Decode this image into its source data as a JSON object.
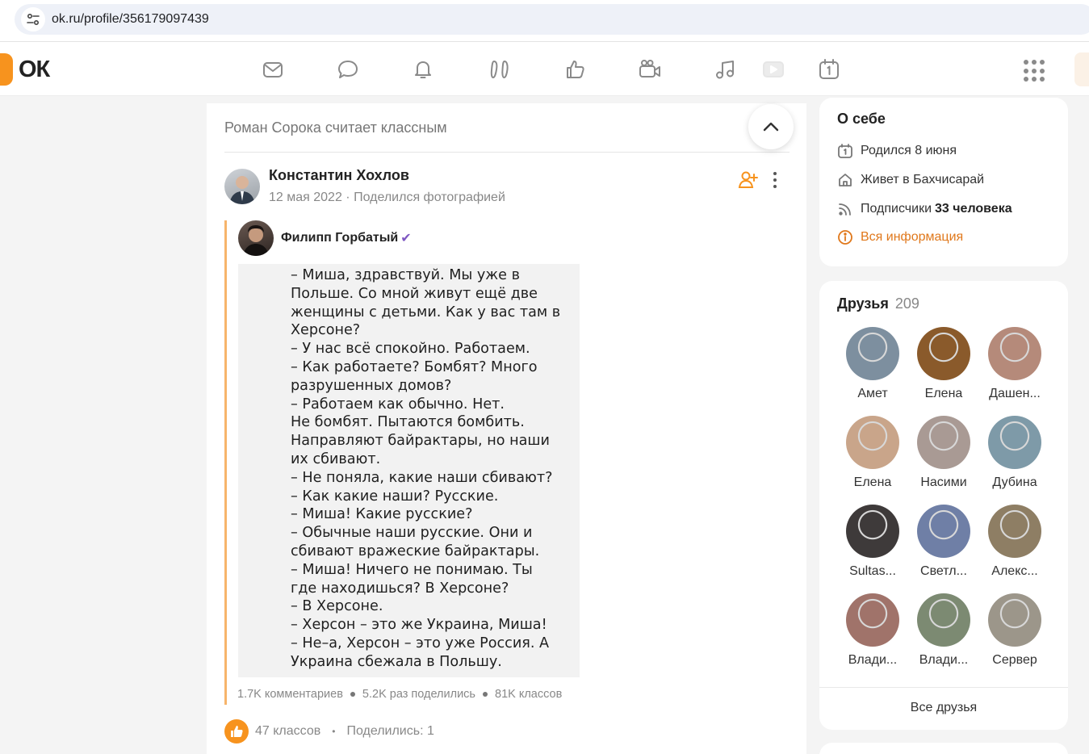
{
  "browser": {
    "url": "ok.ru/profile/356179097439"
  },
  "header": {
    "logo_text": "ОК",
    "nav_icons": [
      "mail-icon",
      "chat-icon",
      "bell-icon",
      "friends-icon",
      "like-icon",
      "video-icon",
      "music-icon",
      "play-icon",
      "calendar-icon"
    ],
    "accent_color": "#f7931e"
  },
  "feed": {
    "activity_header": "Роман Сорока считает классным",
    "post": {
      "author_name": "Константин Хохлов",
      "date": "12 мая 2022",
      "action": "Поделился фотографией",
      "repost": {
        "author_name": "Филипп Горбатый",
        "verified_glyph": "✔",
        "photo_text": "– Миша, здравствуй. Мы уже в\nПольше. Со мной живут ещё две\nженщины с детьми. Как у вас там в\nХерсоне?\n– У нас всё спокойно. Работаем.\n– Как работаете? Бомбят? Много\nразрушенных домов?\n– Работаем как обычно. Нет.\nНе бомбят. Пытаются бомбить.\nНаправляют байрактары, но наши\nих сбивают.\n– Не поняла, какие наши сбивают?\n– Как какие наши? Русские.\n– Миша! Какие русские?\n– Обычные наши русские. Они и\nсбивают вражеские байрактары.\n– Миша! Ничего не понимаю. Ты\nгде находишься? В Херсоне?\n– В Херсоне.\n– Херсон – это же Украина, Миша!\n– Не–а, Херсон – это уже Россия. А\nУкраина сбежала в Польшу.",
        "stats": {
          "comments": "1.7K комментариев",
          "shares": "5.2K раз поделились",
          "klasses": "81K классов"
        }
      },
      "likes": "47 классов",
      "separator": "•",
      "shared": "Поделились: 1"
    }
  },
  "about": {
    "title": "О себе",
    "birthday": "Родился 8 июня",
    "lives": "Живет в Бахчисарай",
    "subscribers_label": "Подписчики",
    "subscribers_value": "33 человека",
    "all_info": "Вся информация"
  },
  "friends": {
    "title": "Друзья",
    "count": "209",
    "items": [
      {
        "name": "Амет",
        "color": "#7d8f9f"
      },
      {
        "name": "Елена",
        "color": "#8a5a2b"
      },
      {
        "name": "Дашен...",
        "color": "#b58a7a"
      },
      {
        "name": "Елена",
        "color": "#c9a58a"
      },
      {
        "name": "Насими",
        "color": "#a99a94"
      },
      {
        "name": "Дубина",
        "color": "#7e9aa8"
      },
      {
        "name": "Sultas...",
        "color": "#3e3a3a"
      },
      {
        "name": "Светл...",
        "color": "#6f7fa6"
      },
      {
        "name": "Алекс...",
        "color": "#8e7e64"
      },
      {
        "name": "Влади...",
        "color": "#a0736a"
      },
      {
        "name": "Влади...",
        "color": "#7c8a72"
      },
      {
        "name": "Сервер",
        "color": "#9c968a"
      }
    ],
    "all_label": "Все друзья"
  }
}
